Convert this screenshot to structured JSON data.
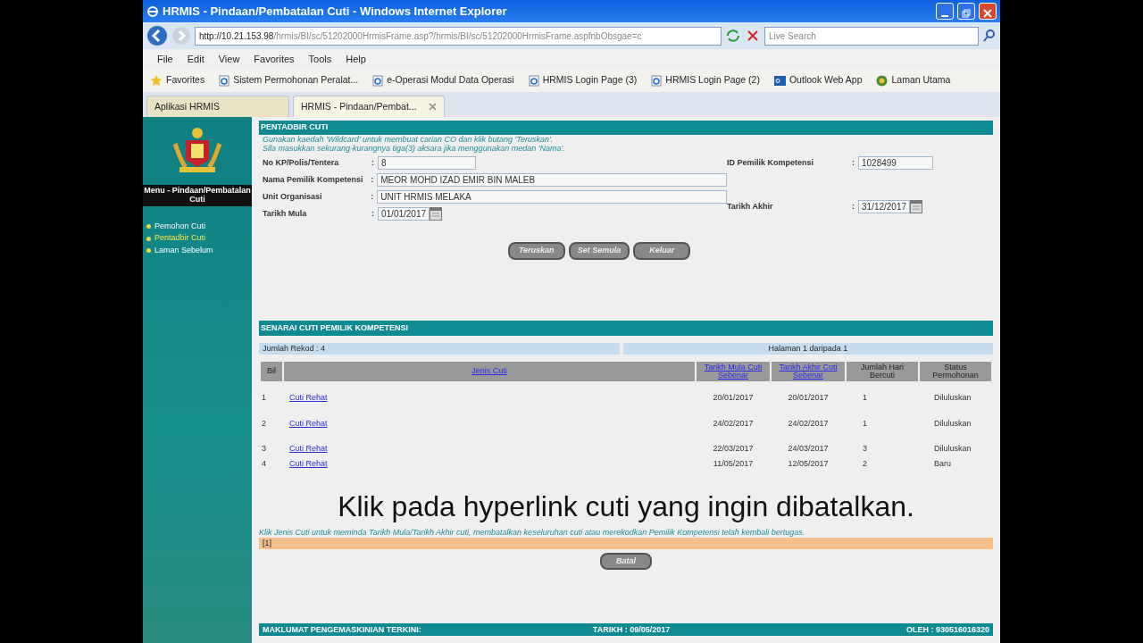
{
  "window": {
    "title": "HRMIS - Pindaan/Pembatalan Cuti - Windows Internet Explorer"
  },
  "browser": {
    "address_host": "http://10.21.153.98",
    "address_path": "/hrmis/BI/sc/51202000HrmisFrame.asp?/hrmis/BI/sc/51202000HrmisFrame.aspfnbObsgae=c",
    "search_placeholder": "Live Search",
    "menu": [
      "File",
      "Edit",
      "View",
      "Favorites",
      "Tools",
      "Help"
    ],
    "favorites_label": "Favorites",
    "favorites": [
      {
        "label": "Sistem Permohonan Peralat...",
        "kind": "page"
      },
      {
        "label": "e-Operasi  Modul Data Operasi",
        "kind": "page"
      },
      {
        "label": "HRMIS Login Page (3)",
        "kind": "page"
      },
      {
        "label": "HRMIS Login Page (2)",
        "kind": "page"
      },
      {
        "label": "Outlook Web App",
        "kind": "outlook"
      },
      {
        "label": "Laman Utama",
        "kind": "site"
      }
    ],
    "tabs": [
      {
        "label": "Aplikasi HRMIS",
        "selected": false
      },
      {
        "label": "HRMIS - Pindaan/Pembat...",
        "selected": true
      }
    ]
  },
  "sidebar": {
    "menu_title": "Menu - Pindaan/Pembatalan Cuti",
    "items": [
      {
        "label": "Pemohon Cuti",
        "selected": false
      },
      {
        "label": "Pentadbir Cuti",
        "selected": true
      },
      {
        "label": "Laman Sebelum",
        "selected": false
      }
    ]
  },
  "form": {
    "title": "PENTADBIR CUTI",
    "hints": [
      "Gunakan kaedah 'Wildcard' untuk membuat carian CO dan klik butang 'Teruskan'.",
      "Sila masukkan sekurang-kurangnya tiga(3) aksara jika menggunakan medan 'Nama'."
    ],
    "no_kp": {
      "label": "No KP/Polis/Tentera",
      "colon": ":",
      "value": "8"
    },
    "id_pemilik": {
      "label": "ID Pemilik Kompetensi",
      "colon": ":",
      "value": "1028499"
    },
    "nama": {
      "label": "Nama Pemilik Kompetensi",
      "colon": ":",
      "value": "MEOR MOHD IZAD EMIR BIN MALEB"
    },
    "unit": {
      "label": "Unit Organisasi",
      "colon": ":",
      "value": "UNIT HRMIS MELAKA"
    },
    "tarikh_mula": {
      "label": "Tarikh Mula",
      "colon": ":",
      "value": "01/01/2017"
    },
    "tarikh_akhir": {
      "label": "Tarikh Akhir",
      "colon": ":",
      "value": "31/12/2017"
    },
    "buttons": [
      "Teruskan",
      "Set Semula",
      "Keluar"
    ]
  },
  "list": {
    "title": "SENARAI CUTI PEMILIK KOMPETENSI",
    "record_count": "Jumlah Rekod : 4",
    "page_info": "Halaman 1 daripada 1",
    "columns": [
      {
        "label": "Bil",
        "link": false
      },
      {
        "label": "Jenis Cuti",
        "link": true
      },
      {
        "label": "Tarikh Mula Cuti Sebenar",
        "link": true
      },
      {
        "label": "Tarikh Akhir Cuti Sebenar",
        "link": true
      },
      {
        "label": "Jumlah Hari Bercuti",
        "link": false
      },
      {
        "label": "Status Permohonan",
        "link": false
      }
    ],
    "rows": [
      [
        "1",
        "Cuti Rehat",
        "20/01/2017",
        "20/01/2017",
        "1",
        "Diluluskan"
      ],
      [
        "2",
        "Cuti Rehat",
        "24/02/2017",
        "24/02/2017",
        "1",
        "Diluluskan"
      ],
      [
        "3",
        "Cuti Rehat",
        "22/03/2017",
        "24/03/2017",
        "3",
        "Diluluskan"
      ],
      [
        "4",
        "Cuti Rehat",
        "11/05/2017",
        "12/05/2017",
        "2",
        "Baru"
      ]
    ]
  },
  "caption": "Klik pada hyperlink cuti yang ingin dibatalkan.",
  "note": "Klik Jenis Cuti untuk meminda Tarikh Mula/Tarikh Akhir cuti, membatalkan keseluruhan cuti atau merekodkan Pemilik Kompetensi telah kembali bertugas.",
  "pager": "[1]",
  "cancel_button": "Batal",
  "footer": {
    "left": "MAKLUMAT PENGEMASKINIAN TERKINI:",
    "center": "TARIKH : 09/05/2017",
    "right": "OLEH : 930516016320"
  }
}
